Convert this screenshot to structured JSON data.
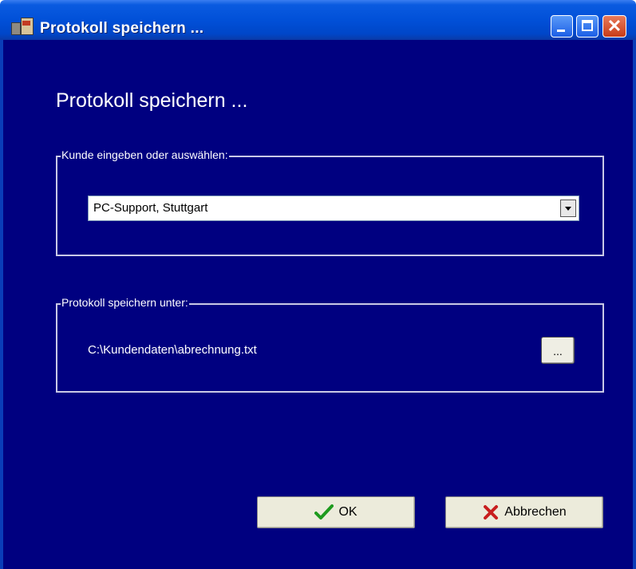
{
  "window": {
    "title": "Protokoll speichern ...",
    "icon": "app-icon",
    "controls": {
      "minimize": "minimize-icon",
      "maximize": "maximize-icon",
      "close": "close-icon"
    }
  },
  "dialog": {
    "heading": "Protokoll speichern ...",
    "customer_group": {
      "label": "Kunde eingeben oder auswählen:",
      "combo_value": "PC-Support, Stuttgart"
    },
    "save_group": {
      "label": "Protokoll speichern unter:",
      "path": "C:\\Kundendaten\\abrechnung.txt",
      "browse_label": "..."
    },
    "buttons": {
      "ok_label": "OK",
      "cancel_label": "Abbrechen"
    }
  },
  "colors": {
    "background": "#000080",
    "titlebar": "#0150d8",
    "ok_icon": "#1e9a1e",
    "cancel_icon": "#c81e1e"
  }
}
